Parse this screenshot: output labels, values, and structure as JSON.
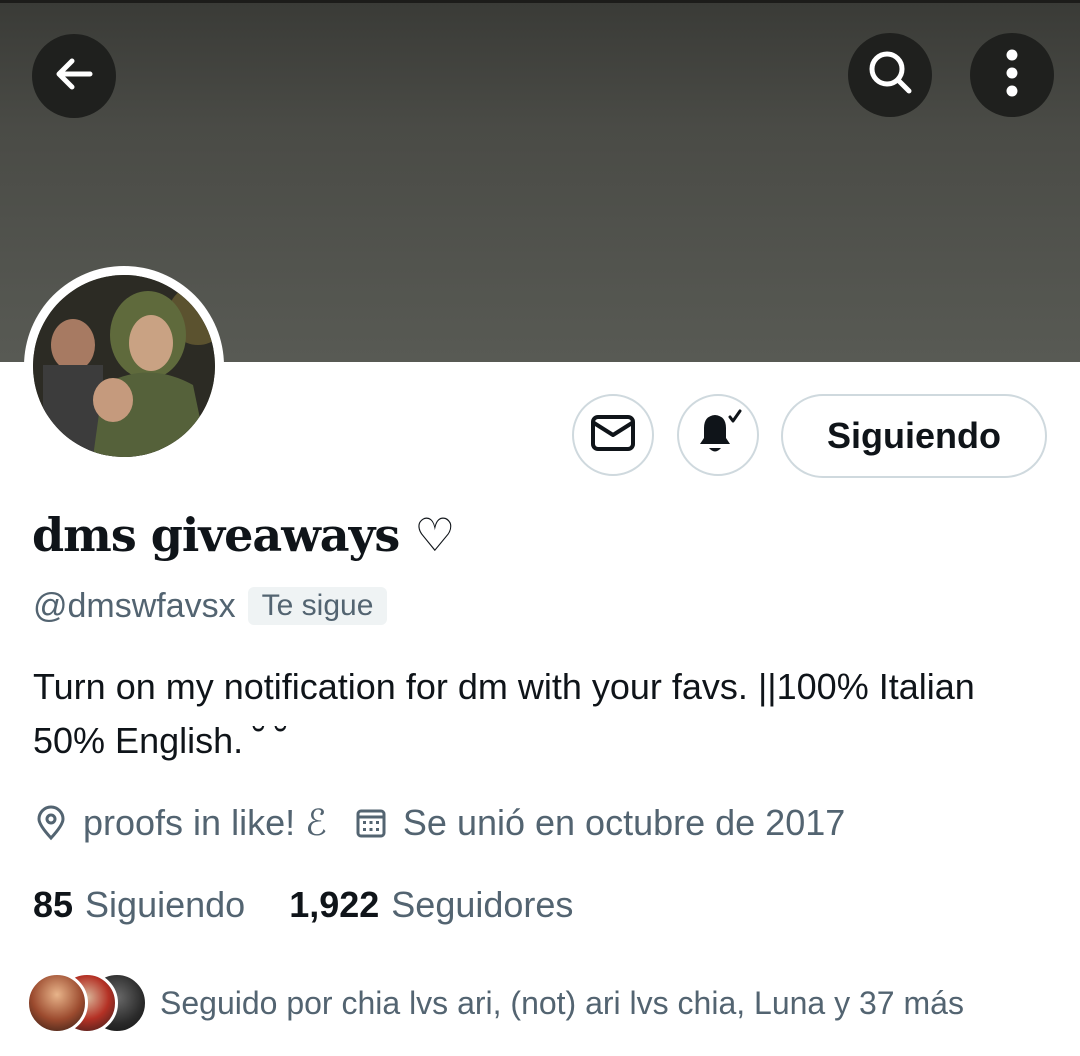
{
  "header": {
    "back_icon": "arrow-left-icon",
    "search_icon": "search-icon",
    "more_icon": "more-vertical-icon"
  },
  "actions": {
    "message_icon": "envelope-icon",
    "notify_icon": "bell-check-icon",
    "follow_label": "Siguiendo"
  },
  "profile": {
    "display_name": "dms giveaways ♡",
    "handle": "@dmswfavsx",
    "follows_you_badge": "Te sigue",
    "bio": "Turn on my notification for dm with your favs. ||100% Italian 50% English. ˘ ˘",
    "location": "proofs in like! ℰ",
    "joined": "Se unió en octubre de 2017"
  },
  "stats": {
    "following_count": "85",
    "following_label": "Siguiendo",
    "followers_count": "1,922",
    "followers_label": "Seguidores"
  },
  "followed_by": {
    "text": "Seguido por chia lvs ari, (not) ari lvs chia, Luna y 37 más"
  },
  "colors": {
    "text_primary": "#0f1419",
    "text_secondary": "#536471",
    "border": "#cfd9de",
    "banner": "#585a54"
  }
}
